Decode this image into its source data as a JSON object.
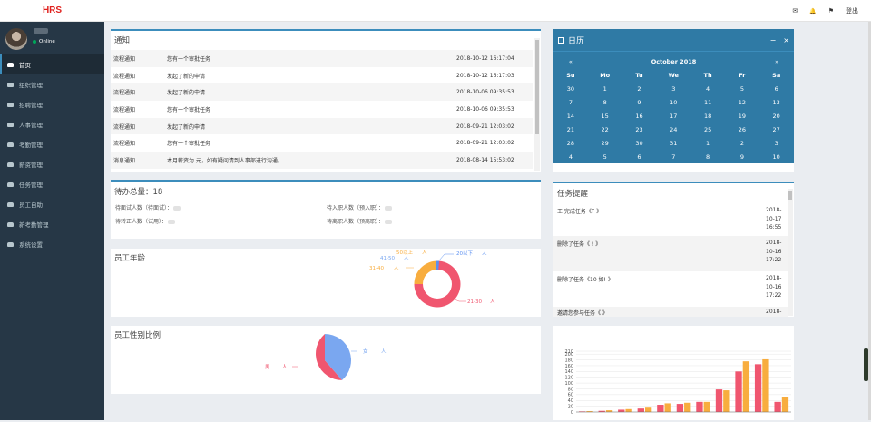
{
  "brand": "HRS",
  "topbar": {
    "mail": "✉",
    "bell": "🔔",
    "flag": "⚑",
    "logout": "登出"
  },
  "user": {
    "status": "Online"
  },
  "menu": [
    "首页",
    "组织管理",
    "招聘管理",
    "人事管理",
    "考勤管理",
    "薪资管理",
    "任务管理",
    "员工自助",
    "新考勤管理",
    "系统设置"
  ],
  "notice": {
    "title": "通知",
    "rows": [
      {
        "type": "流程通知",
        "msg": "您有一个审批任务",
        "time": "2018-10-12 16:17:04"
      },
      {
        "type": "流程通知",
        "msg": "发起了新的申请",
        "time": "2018-10-12 16:17:03"
      },
      {
        "type": "流程通知",
        "msg": "发起了新的申请",
        "time": "2018-10-06 09:35:53"
      },
      {
        "type": "流程通知",
        "msg": "您有一个审批任务",
        "time": "2018-10-06 09:35:53"
      },
      {
        "type": "流程通知",
        "msg": "发起了新的申请",
        "time": "2018-09-21 12:03:02"
      },
      {
        "type": "流程通知",
        "msg": "您有一个审批任务",
        "time": "2018-09-21 12:03:02"
      },
      {
        "type": "消息通知",
        "msg": "本月薪资为    元，如有疑问请到人事部进行沟通。",
        "time": "2018-08-14 15:53:02"
      }
    ]
  },
  "todo": {
    "title": "待办总量：18",
    "l1": "待面试人数（待面试）：",
    "l2": "待转正人数（试用）：",
    "r1": "待入职人数（预入职）：",
    "r2": "待离职人数（预离职）："
  },
  "age": {
    "title": "员工年龄",
    "labels": {
      "a": "20以下",
      "b": "21-30",
      "c": "31-40",
      "d": "41-50",
      "e": "50以上"
    },
    "unit": "人"
  },
  "gender": {
    "title": "员工性别比例",
    "female": "女",
    "male": "男",
    "unit": "人"
  },
  "calendar": {
    "title": "日历",
    "month": "October 2018",
    "prev": "«",
    "next": "»",
    "minus": "−",
    "close": "×",
    "days": [
      "Su",
      "Mo",
      "Tu",
      "We",
      "Th",
      "Fr",
      "Sa"
    ],
    "weeks": [
      [
        "30",
        "1",
        "2",
        "3",
        "4",
        "5",
        "6"
      ],
      [
        "7",
        "8",
        "9",
        "10",
        "11",
        "12",
        "13"
      ],
      [
        "14",
        "15",
        "16",
        "17",
        "18",
        "19",
        "20"
      ],
      [
        "21",
        "22",
        "23",
        "24",
        "25",
        "26",
        "27"
      ],
      [
        "28",
        "29",
        "30",
        "31",
        "1",
        "2",
        "3"
      ],
      [
        "4",
        "5",
        "6",
        "7",
        "8",
        "9",
        "10"
      ]
    ]
  },
  "task": {
    "title": "任务提醒",
    "items": [
      {
        "text": "王    完成任务《F   》",
        "d1": "2018-",
        "d2": "10-17",
        "d3": "16:55"
      },
      {
        "text": "    删除了任务《                   ! 》",
        "d1": "2018-",
        "d2": "10-16",
        "d3": "17:22"
      },
      {
        "text": "    删除了任务《10                  如! 》",
        "d1": "2018-",
        "d2": "10-16",
        "d3": "17:22"
      },
      {
        "text": "    邀请您参与任务《                     》",
        "d1": "2018-",
        "d2": "",
        "d3": ""
      }
    ]
  },
  "chart_data": {
    "type": "bar",
    "yticks": [
      "0",
      "20",
      "40",
      "60",
      "80",
      "100",
      "120",
      "140",
      "160",
      "180",
      "200",
      "210"
    ],
    "ylim": [
      0,
      210
    ],
    "series": [
      {
        "color": "#f0566f",
        "values": [
          2,
          4,
          8,
          12,
          25,
          28,
          35,
          78,
          140,
          165,
          35
        ]
      },
      {
        "color": "#f8ad3e",
        "values": [
          3,
          6,
          10,
          15,
          30,
          32,
          35,
          75,
          175,
          182,
          52
        ]
      }
    ]
  },
  "colors": {
    "accent": "#3c8dbc",
    "pink": "#f0566f",
    "orange": "#f8ad3e",
    "blue": "#7aa7f0"
  }
}
